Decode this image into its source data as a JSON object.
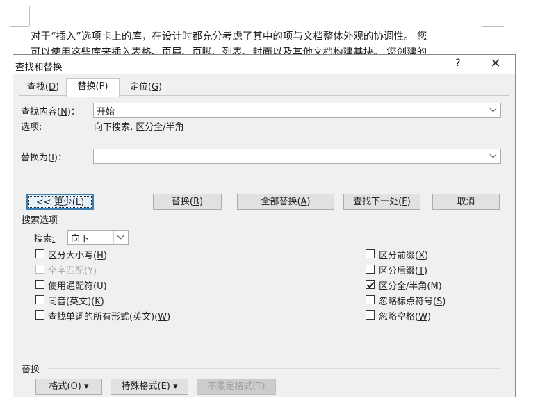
{
  "document": {
    "line1": "对于“插入”选项卡上的库，在设计时都充分考虑了其中的项与文档整体外观的协调性。 您",
    "line2": "可以使用这些库来插入表格、页眉、页脚、列表、封面以及其他文档构建基块。 您创建的"
  },
  "dialog": {
    "title": "查找和替换",
    "help": "?",
    "close": "✕"
  },
  "tabs": {
    "find": {
      "text": "查找(",
      "key": "D",
      "end": ")"
    },
    "replace": {
      "text": "替换(",
      "key": "P",
      "end": ")"
    },
    "goto": {
      "text": "定位(",
      "key": "G",
      "end": ")"
    }
  },
  "find_what": {
    "label_text": "查找内容(",
    "key": "N",
    "label_end": ")：",
    "value": "开始"
  },
  "options_summary": {
    "label": "选项:",
    "value": "向下搜索, 区分全/半角"
  },
  "replace_with": {
    "label_text": "替换为(",
    "key": "I",
    "label_end": ")：",
    "value": ""
  },
  "buttons": {
    "less": {
      "text": "<< 更少(",
      "key": "L",
      "end": ")"
    },
    "replace": {
      "text": "替换(",
      "key": "R",
      "end": ")"
    },
    "replace_all": {
      "text": "全部替换(",
      "key": "A",
      "end": ")"
    },
    "find_next": {
      "text": "查找下一处(",
      "key": "F",
      "end": ")"
    },
    "cancel": "取消"
  },
  "search_options": {
    "group_label": "搜索选项",
    "search_label": "搜索",
    "search_key": ":",
    "direction": "向下"
  },
  "left_options": [
    {
      "text": "区分大小写(",
      "key": "H",
      "end": ")",
      "checked": false,
      "enabled": true
    },
    {
      "text": "全字匹配(Y)",
      "key": "",
      "end": "",
      "checked": false,
      "enabled": false
    },
    {
      "text": "使用通配符(",
      "key": "U",
      "end": ")",
      "checked": false,
      "enabled": true
    },
    {
      "text": "同音(英文)(",
      "key": "K",
      "end": ")",
      "checked": false,
      "enabled": true
    },
    {
      "text": "查找单词的所有形式(英文)(",
      "key": "W",
      "end": ")",
      "checked": false,
      "enabled": true
    }
  ],
  "right_options": [
    {
      "text": "区分前缀(",
      "key": "X",
      "end": ")",
      "checked": false
    },
    {
      "text": "区分后缀(",
      "key": "T",
      "end": ")",
      "checked": false
    },
    {
      "text": "区分全/半角(",
      "key": "M",
      "end": ")",
      "checked": true
    },
    {
      "text": "忽略标点符号(",
      "key": "S",
      "end": ")",
      "checked": false
    },
    {
      "text": "忽略空格(",
      "key": "W",
      "end": ")",
      "checked": false
    }
  ],
  "replace_group": {
    "label": "替换",
    "format": {
      "text": "格式(",
      "key": "O",
      "end": ") ▾"
    },
    "special": {
      "text": "特殊格式(",
      "key": "E",
      "end": ") ▾"
    },
    "no_format": "不限定格式(T)"
  }
}
